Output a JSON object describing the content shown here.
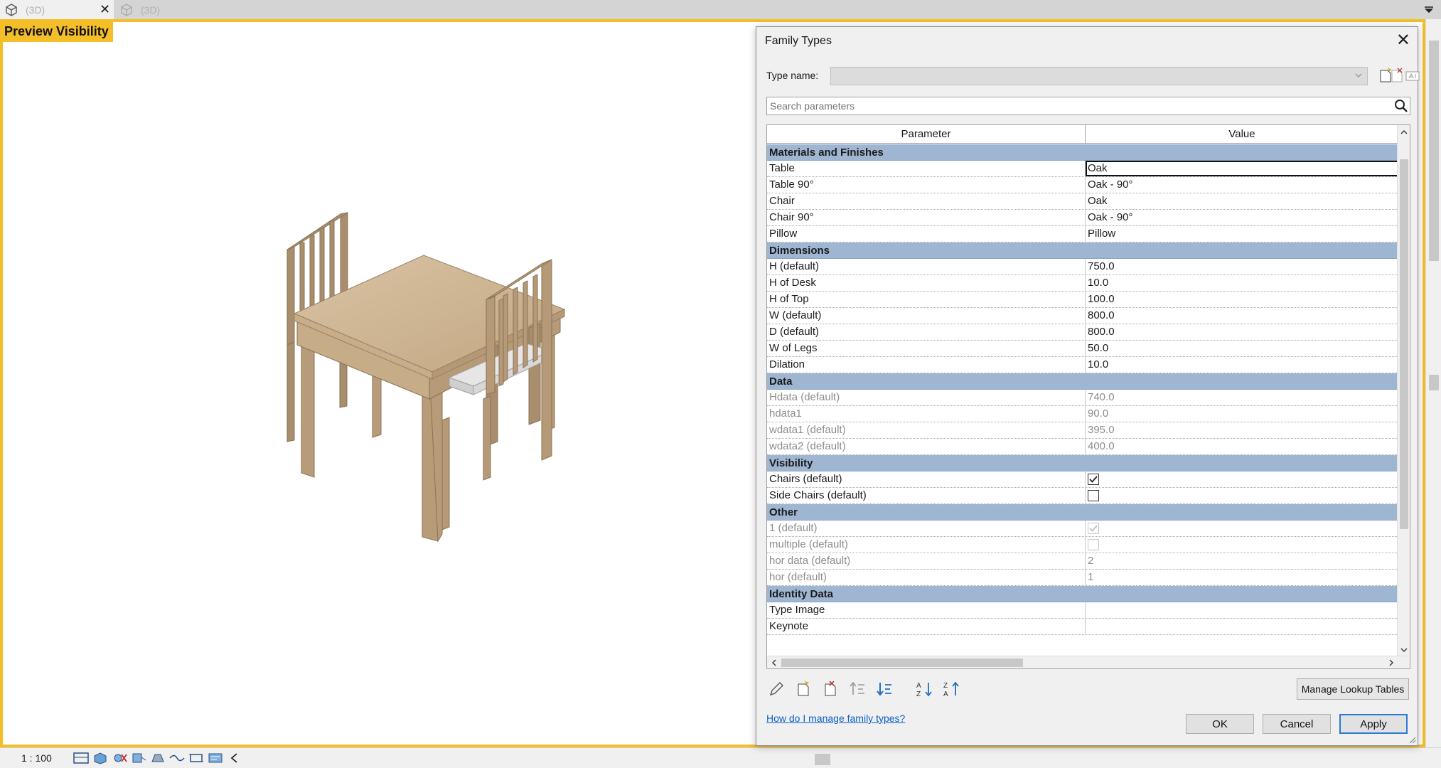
{
  "tabs": [
    {
      "label": "(3D)",
      "active": true
    },
    {
      "label": "(3D)",
      "active": false
    }
  ],
  "viewport": {
    "label": "Preview Visibility",
    "highlight_color": "#f4be28"
  },
  "statusbar": {
    "scale": "1 : 100"
  },
  "dialog": {
    "title": "Family Types",
    "type_name_label": "Type name:",
    "search_placeholder": "Search parameters",
    "columns": {
      "parameter": "Parameter",
      "value": "Value"
    },
    "groups": [
      {
        "name": "Materials and Finishes",
        "rows": [
          {
            "param": "Table",
            "value": "Oak",
            "selected": true
          },
          {
            "param": "Table 90°",
            "value": "Oak - 90°"
          },
          {
            "param": "Chair",
            "value": "Oak"
          },
          {
            "param": "Chair 90°",
            "value": "Oak - 90°"
          },
          {
            "param": "Pillow",
            "value": "Pillow"
          }
        ]
      },
      {
        "name": "Dimensions",
        "rows": [
          {
            "param": "H (default)",
            "value": "750.0"
          },
          {
            "param": "H of Desk",
            "value": "10.0"
          },
          {
            "param": "H of Top",
            "value": "100.0"
          },
          {
            "param": "W (default)",
            "value": "800.0"
          },
          {
            "param": "D (default)",
            "value": "800.0"
          },
          {
            "param": "W of Legs",
            "value": "50.0"
          },
          {
            "param": "Dilation",
            "value": "10.0"
          }
        ]
      },
      {
        "name": "Data",
        "rows": [
          {
            "param": "Hdata (default)",
            "value": "740.0",
            "dim": true
          },
          {
            "param": "hdata1",
            "value": "90.0",
            "dim": true
          },
          {
            "param": "wdata1 (default)",
            "value": "395.0",
            "dim": true
          },
          {
            "param": "wdata2 (default)",
            "value": "400.0",
            "dim": true
          }
        ]
      },
      {
        "name": "Visibility",
        "rows": [
          {
            "param": "Chairs (default)",
            "checkbox": true,
            "checked": true
          },
          {
            "param": "Side Chairs (default)",
            "checkbox": true,
            "checked": false
          }
        ]
      },
      {
        "name": "Other",
        "rows": [
          {
            "param": "1 (default)",
            "checkbox": true,
            "checked": true,
            "dim": true
          },
          {
            "param": "multiple (default)",
            "checkbox": true,
            "checked": false,
            "dim": true
          },
          {
            "param": "hor data (default)",
            "value": "2",
            "dim": true
          },
          {
            "param": "hor (default)",
            "value": "1",
            "dim": true
          }
        ]
      },
      {
        "name": "Identity Data",
        "rows": [
          {
            "param": "Type Image",
            "value": ""
          },
          {
            "param": "Keynote",
            "value": ""
          }
        ]
      }
    ],
    "toolbar_icons": [
      "edit-pencil-icon",
      "new-parameter-icon",
      "delete-parameter-icon",
      "move-up-icon",
      "move-down-icon",
      "sort-ascending-icon",
      "sort-descending-icon"
    ],
    "manage_lookup_label": "Manage Lookup Tables",
    "help_link": "How do I manage family types?",
    "ok_label": "OK",
    "cancel_label": "Cancel",
    "apply_label": "Apply",
    "colors": {
      "group_header": "#9fb6d3",
      "link": "#0b5fc6",
      "accent": "#2a7ad6"
    }
  }
}
